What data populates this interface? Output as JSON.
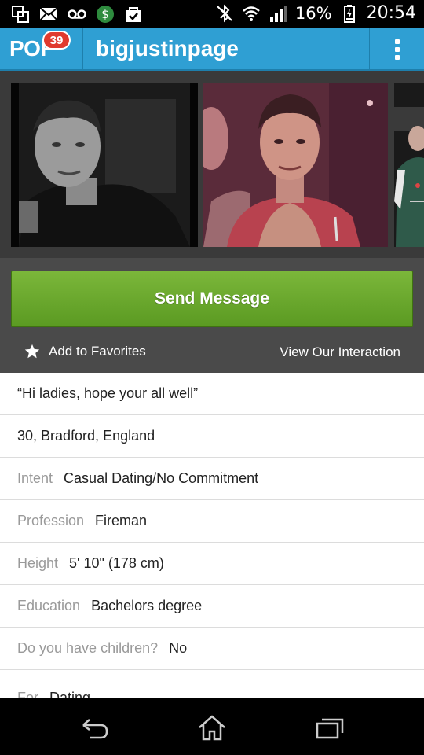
{
  "status_bar": {
    "battery": "16%",
    "time": "20:54",
    "icons": [
      "screen-mirror-icon",
      "mail-icon",
      "voicemail-icon",
      "money-app-icon",
      "shopping-bag-icon",
      "bluetooth-off-icon",
      "wifi-icon",
      "signal-icon",
      "battery-charging-icon"
    ]
  },
  "header": {
    "logo": "POF",
    "badge_count": "39",
    "title": "bigjustinpage",
    "menu_icon": "overflow-menu-icon"
  },
  "photos": [
    {
      "alt": "profile-photo-1"
    },
    {
      "alt": "profile-photo-2"
    },
    {
      "alt": "profile-photo-3"
    }
  ],
  "actions": {
    "send_message": "Send Message",
    "add_favorites": "Add to Favorites",
    "view_interaction": "View Our Interaction"
  },
  "profile": {
    "headline": "“Hi ladies, hope your all well”",
    "location": "30, Bradford, England",
    "fields": [
      {
        "label": "Intent",
        "value": "Casual Dating/No Commitment"
      },
      {
        "label": "Profession",
        "value": "Fireman"
      },
      {
        "label": "Height",
        "value": "5' 10\" (178 cm)"
      },
      {
        "label": "Education",
        "value": "Bachelors degree"
      },
      {
        "label": "Do you have children?",
        "value": "No"
      },
      {
        "label": "For",
        "value": "Dating"
      }
    ]
  },
  "navbar": {
    "icons": [
      "back-icon",
      "home-icon",
      "recent-apps-icon"
    ]
  },
  "colors": {
    "header": "#2f9fd3",
    "send_button": "#6aa82e",
    "badge": "#e03a2e"
  }
}
